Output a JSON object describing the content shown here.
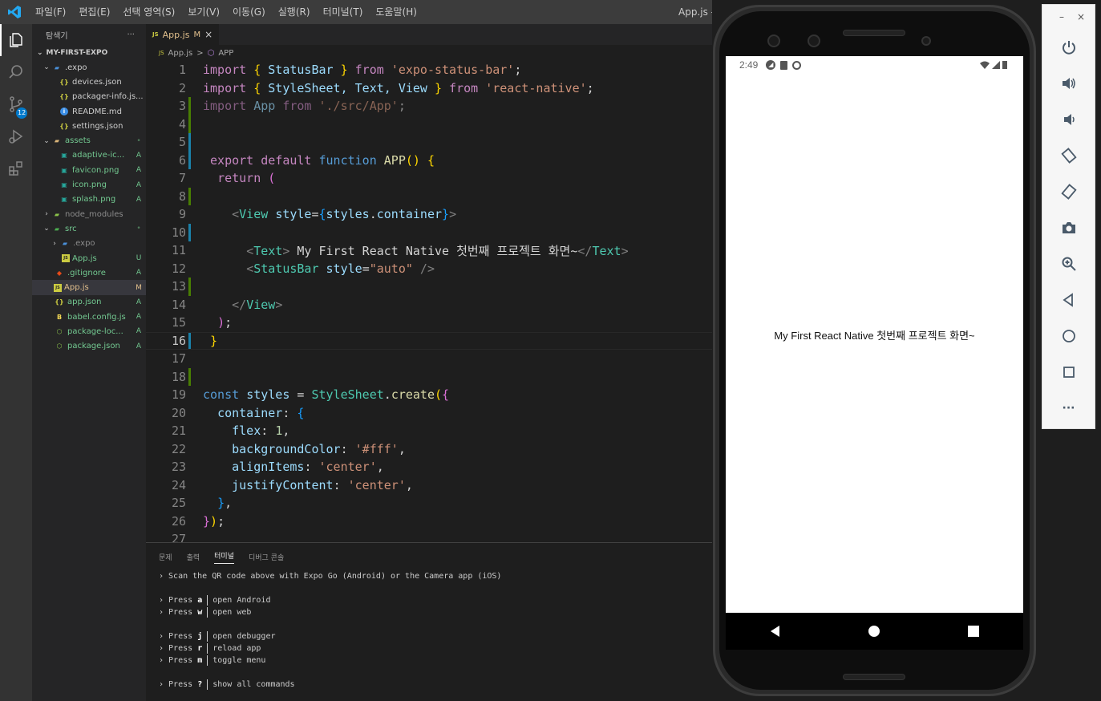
{
  "titlebar": {
    "menus": [
      "파일(F)",
      "편집(E)",
      "선택 영역(S)",
      "보기(V)",
      "이동(G)",
      "실행(R)",
      "터미널(T)",
      "도움말(H)"
    ],
    "window_title": "App.js - my"
  },
  "activity": {
    "scm_badge": "12"
  },
  "sidebar": {
    "title": "탐색기",
    "more": "···",
    "project": "MY-FIRST-EXPO",
    "rows": [
      {
        "name": ".expo",
        "status": ""
      },
      {
        "name": "devices.json",
        "status": ""
      },
      {
        "name": "packager-info.js...",
        "status": ""
      },
      {
        "name": "README.md",
        "status": ""
      },
      {
        "name": "settings.json",
        "status": ""
      },
      {
        "name": "assets",
        "status": "•"
      },
      {
        "name": "adaptive-ic...",
        "status": "A"
      },
      {
        "name": "favicon.png",
        "status": "A"
      },
      {
        "name": "icon.png",
        "status": "A"
      },
      {
        "name": "splash.png",
        "status": "A"
      },
      {
        "name": "node_modules",
        "status": ""
      },
      {
        "name": "src",
        "status": "•"
      },
      {
        "name": ".expo",
        "status": ""
      },
      {
        "name": "App.js",
        "status": "U"
      },
      {
        "name": ".gitignore",
        "status": "A"
      },
      {
        "name": "App.js",
        "status": "M"
      },
      {
        "name": "app.json",
        "status": "A"
      },
      {
        "name": "babel.config.js",
        "status": "A"
      },
      {
        "name": "package-loc...",
        "status": "A"
      },
      {
        "name": "package.json",
        "status": "A"
      }
    ]
  },
  "editor": {
    "tab": {
      "icon": "JS",
      "name": "App.js",
      "status": "M",
      "close": "×"
    },
    "breadcrumb": {
      "file": "App.js",
      "sep": ">",
      "symbol": "APP"
    },
    "line_numbers": [
      "1",
      "2",
      "3",
      "4",
      "5",
      "6",
      "7",
      "8",
      "9",
      "10",
      "11",
      "12",
      "13",
      "14",
      "15",
      "16",
      "17",
      "18",
      "19",
      "20",
      "21",
      "22",
      "23",
      "24",
      "25",
      "26",
      "27"
    ],
    "code": {
      "l1": [
        "import",
        " ",
        "{",
        " StatusBar ",
        "}",
        " from ",
        "'expo-status-bar'",
        ";"
      ],
      "l2": [
        "import",
        " ",
        "{",
        " StyleSheet, Text, View ",
        "}",
        " from ",
        "'react-native'",
        ";"
      ],
      "l3": [
        "import",
        " App ",
        "from",
        " ",
        "'./src/App'",
        ";"
      ],
      "l6": [
        "export",
        " ",
        "default",
        " ",
        "function",
        " ",
        "APP",
        "(",
        ")",
        " ",
        "{"
      ],
      "l7": [
        "return",
        " ",
        "("
      ],
      "l9": [
        "<",
        "View",
        " ",
        "style",
        "=",
        "{",
        "styles",
        ".",
        "container",
        "}",
        ">"
      ],
      "l11": [
        "<",
        "Text",
        ">",
        " My First React Native 첫번째 프로젝트 화면~",
        "</",
        "Text",
        ">"
      ],
      "l12": [
        "<",
        "StatusBar",
        " ",
        "style",
        "=",
        "\"auto\"",
        " />"
      ],
      "l14": [
        "</",
        "View",
        ">"
      ],
      "l15": [
        ")",
        ";"
      ],
      "l16": [
        "}"
      ],
      "l19": [
        "const",
        " ",
        "styles",
        " = ",
        "StyleSheet",
        ".",
        "create",
        "(",
        "{"
      ],
      "l20": [
        "container",
        ": ",
        "{"
      ],
      "l21": [
        "flex",
        ": ",
        "1",
        ","
      ],
      "l22": [
        "backgroundColor",
        ": ",
        "'#fff'",
        ","
      ],
      "l23": [
        "alignItems",
        ": ",
        "'center'",
        ","
      ],
      "l24": [
        "justifyContent",
        ": ",
        "'center'",
        ","
      ],
      "l25": [
        "}",
        ","
      ],
      "l26": [
        "}",
        ")",
        ";"
      ]
    }
  },
  "panel": {
    "tabs": [
      "문제",
      "출력",
      "터미널",
      "디버그 콘솔"
    ],
    "active_tab": "터미널",
    "terminal": {
      "scan": "› Scan the QR code above with Expo Go (Android) or the Camera app (iOS)",
      "prompt": "› Press",
      "cmds": [
        {
          "key": "a",
          "desc": "open Android"
        },
        {
          "key": "w",
          "desc": "open web"
        },
        {
          "key": "j",
          "desc": "open debugger"
        },
        {
          "key": "r",
          "desc": "reload app"
        },
        {
          "key": "m",
          "desc": "toggle menu"
        },
        {
          "key": "?",
          "desc": "show all commands"
        }
      ]
    }
  },
  "phone": {
    "time": "2:49",
    "app_text": "My First React Native 첫번째 프로젝트 화면~"
  },
  "emulator": {
    "minimize": "–",
    "close": "×",
    "more": "···"
  },
  "colors": {
    "accent": "#007acc",
    "modified": "#e2c08d",
    "added": "#73c991",
    "untracked": "#73c991"
  }
}
